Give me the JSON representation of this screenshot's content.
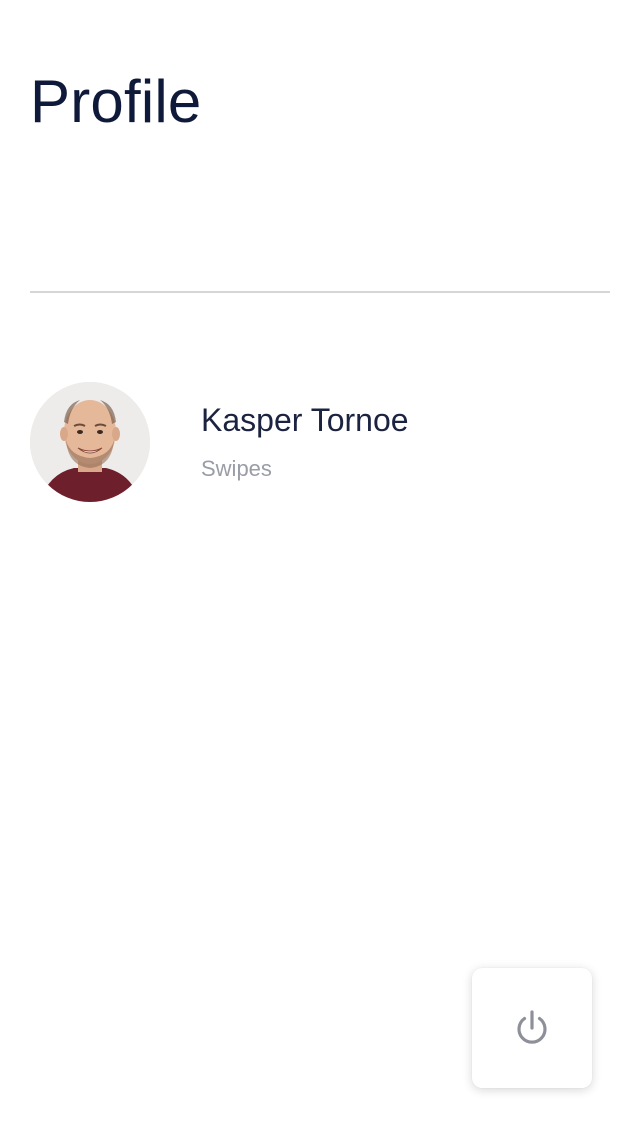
{
  "header": {
    "title": "Profile"
  },
  "profile": {
    "name": "Kasper Tornoe",
    "subtitle": "Swipes",
    "avatar_icon": "user-photo"
  },
  "actions": {
    "logout_icon": "power-icon"
  },
  "colors": {
    "title": "#0f1a3b",
    "name": "#1c2340",
    "subtitle": "#9a9ca6",
    "divider": "#d6d6d8",
    "icon": "#8e9099"
  }
}
